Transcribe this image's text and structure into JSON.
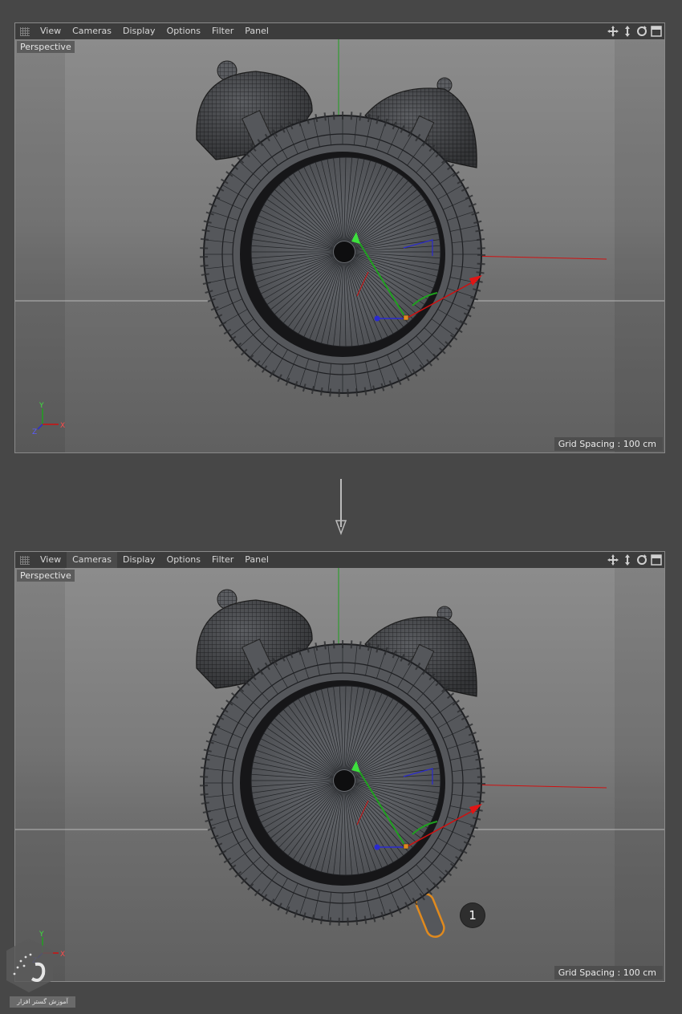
{
  "menu": {
    "items": [
      "View",
      "Cameras",
      "Display",
      "Options",
      "Filter",
      "Panel"
    ]
  },
  "viewport_top": {
    "camera_label": "Perspective",
    "grid_spacing": "Grid Spacing : 100 cm",
    "active_menu": ""
  },
  "viewport_bottom": {
    "camera_label": "Perspective",
    "grid_spacing": "Grid Spacing : 100 cm",
    "active_menu": "Cameras"
  },
  "axes": {
    "y": "Y",
    "x": "X",
    "z": "Z"
  },
  "step_badge": "1",
  "watermark_text": "آموزش گستر افزار",
  "colors": {
    "background": "#474747",
    "x_axis": "#d01010",
    "y_axis": "#1fa01f",
    "z_axis": "#2a2ad0",
    "highlight_orange": "#e08a1e"
  },
  "icons": [
    "grip-icon",
    "move-view-icon",
    "zoom-view-icon",
    "rotate-view-icon",
    "maximize-view-icon",
    "arrow-down-icon"
  ]
}
